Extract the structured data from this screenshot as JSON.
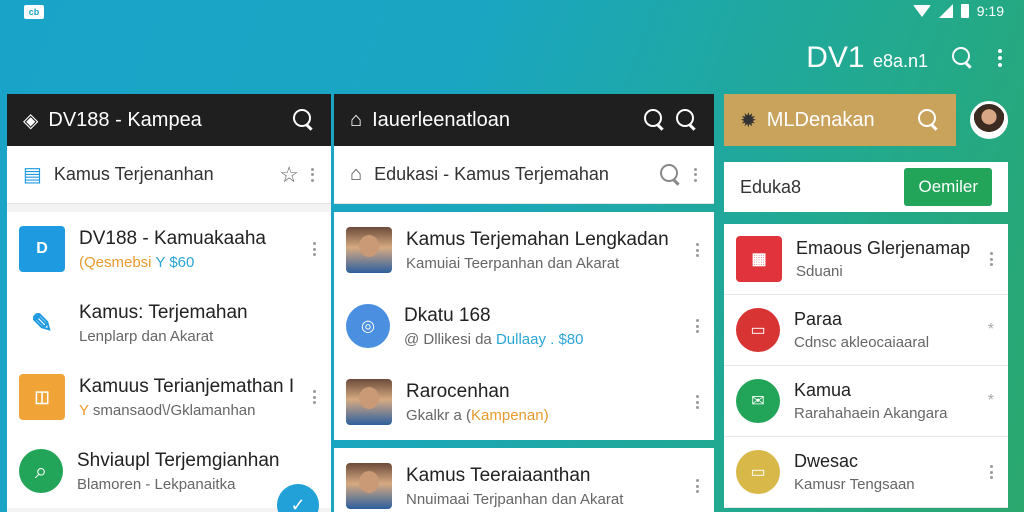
{
  "status": {
    "time": "9:19",
    "left_badge": "cb"
  },
  "appbar": {
    "title": "DV1",
    "title_suffix": "e8a.n1"
  },
  "panel1": {
    "topbar_title": "DV188 - Kampea",
    "subbar_title": "Kamus Terjenanhan",
    "items": [
      {
        "t1": "DV188 - Kamuakaaha",
        "t2a": "(Qesmebsi",
        "t2b": "Y $60",
        "color": "#1e9ae0",
        "glyph": "D"
      },
      {
        "t1": "Kamus: Terjemahan",
        "t2a": "Lenplarp dan Akarat",
        "t2b": "",
        "color": "#ffffff",
        "glyph": "✎"
      },
      {
        "t1": "Kamuus Terianjemathan I",
        "t2a": "Y",
        "t2b": "smansaod\\/Gklamanhan",
        "color": "#f0a437",
        "glyph": "◫"
      },
      {
        "t1": "Shviaupl Terjemgianhan",
        "t2a": "Blamoren - Lekpanaitka",
        "t2b": "",
        "color": "#22a559",
        "glyph": "⌕"
      }
    ]
  },
  "panel2": {
    "topbar_title": "Iauerleenatloan",
    "subbar_title": "Edukasi - Kamus Terjemahan",
    "items": [
      {
        "t1": "Kamus Terjemahan Lengkadan",
        "t2a": "Kamuiai Teerpanhan dan Akarat",
        "t2b": ""
      },
      {
        "t1": "Dkatu 168",
        "t2a": "@ Dllikesi da",
        "t2b": "Dullaay . $80"
      },
      {
        "t1": "Rarocenhan",
        "t2a": "Gkalkr a (",
        "t2b": "Kampenan)"
      },
      {
        "t1": "Kamus Teeraiaanthan",
        "t2a": "Nnuimaai Terjpanhan dan Akarat",
        "t2b": ""
      }
    ]
  },
  "panel3": {
    "topbar_title": "MLDenakan",
    "input_value": "Eduka8",
    "button_label": "Oemiler",
    "items": [
      {
        "t1": "Emaous Glerjenamap",
        "t2": "Sduani",
        "color": "#e0333b"
      },
      {
        "t1": "Paraa",
        "t2": "Cdnsc akleocaiaaral",
        "color": "#d93434"
      },
      {
        "t1": "Kamua",
        "t2": "Rarahahaein Akangara",
        "color": "#22a559"
      },
      {
        "t1": "Dwesac",
        "t2": "Kamusr Tengsaan",
        "color": "#d9b84a"
      }
    ]
  },
  "colors": {
    "accent": "#22a559",
    "blue": "#1e9ae0",
    "gold": "#c9a35c"
  }
}
